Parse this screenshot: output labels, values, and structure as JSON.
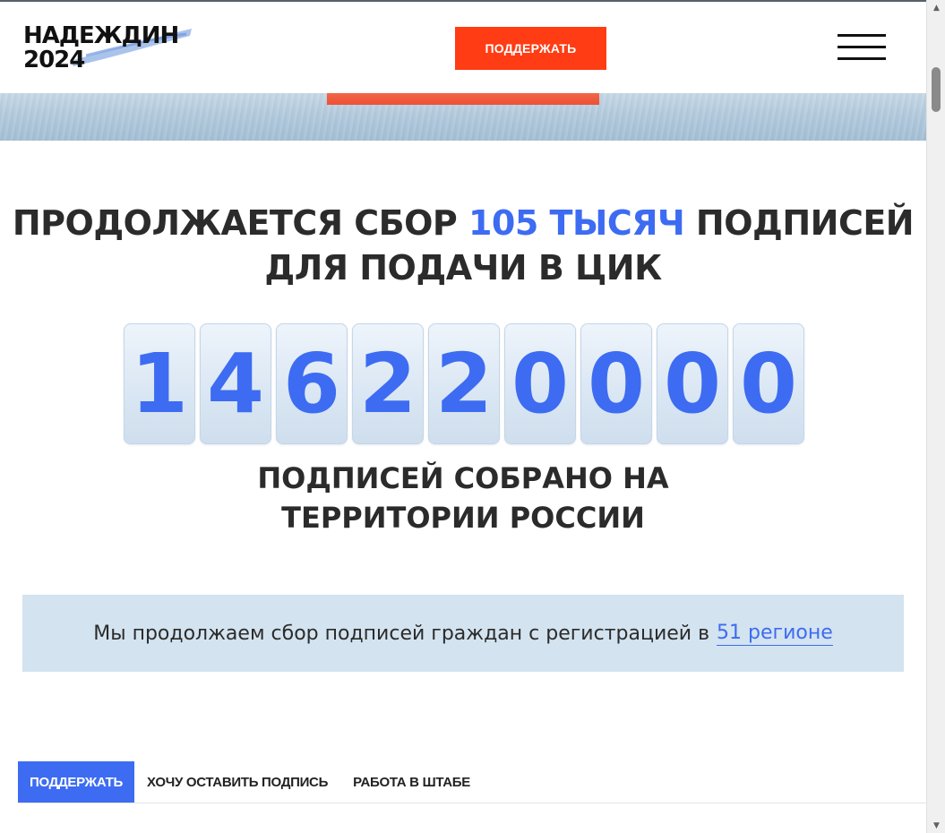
{
  "header": {
    "logo_line1": "НАДЕЖДИН",
    "logo_line2": "2024",
    "support_button": "ПОДДЕРЖАТЬ",
    "menu_icon": "hamburger-menu-icon"
  },
  "headline": {
    "part1": "ПРОДОЛЖАЕТСЯ СБОР ",
    "accent": "105 ТЫСЯЧ",
    "part2": " ПОДПИСЕЙ",
    "line2": "ДЛЯ ПОДАЧИ В ЦИК"
  },
  "counter": {
    "digits": [
      "1",
      "4",
      "6",
      "2",
      "2",
      "0",
      "0",
      "0",
      "0"
    ]
  },
  "subline": {
    "line1": "ПОДПИСЕЙ СОБРАНО НА",
    "line2": "ТЕРРИТОРИИ РОССИИ"
  },
  "info": {
    "text": "Мы продолжаем сбор подписей граждан с регистрацией в",
    "link": "51 регионе"
  },
  "tabs": [
    {
      "label": "ПОДДЕРЖАТЬ",
      "active": true
    },
    {
      "label": "ХОЧУ ОСТАВИТЬ ПОДПИСЬ",
      "active": false
    },
    {
      "label": "РАБОТА В ШТАБЕ",
      "active": false
    }
  ],
  "colors": {
    "accent_blue": "#3d6cf2",
    "brand_red": "#ff3c14",
    "info_bg": "#d3e3ef"
  }
}
